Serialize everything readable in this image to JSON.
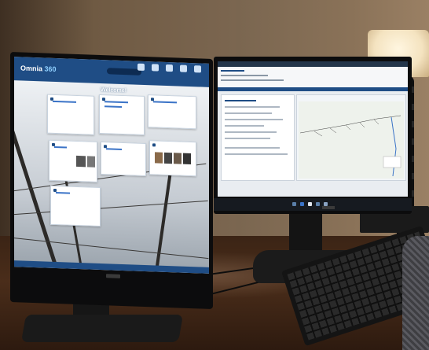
{
  "scene": {
    "description_type": "photo",
    "colors": {
      "app_blue": "#1f4d85",
      "desk_wood": "#4a2d1a",
      "wall": "#7b6650"
    }
  },
  "left_screen": {
    "app_name": "Omnia",
    "app_name_suffix": "360",
    "welcome": "Welcome!"
  }
}
